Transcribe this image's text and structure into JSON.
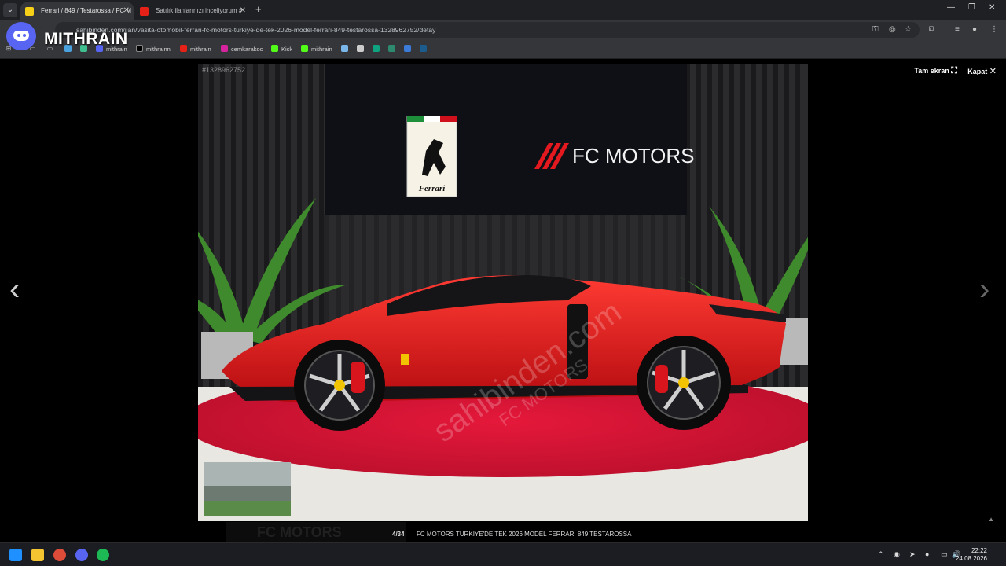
{
  "browser": {
    "tabs": [
      {
        "title": "Ferrari / 849 / Testarossa / FC M",
        "active": true
      },
      {
        "title": "Satılık ilanlarınızı inceliyorum #",
        "active": false
      }
    ],
    "url": "sahibinden.com/ilan/vasita-otomobil-ferrari-fc-motors-turkiye-de-tek-2026-model-ferrari-849-testarossa-1328962752/detay",
    "bookmarks": [
      "mithrain",
      "mithrainn",
      "mithrain",
      "cemkarakoc",
      "Kick",
      "mithrain"
    ]
  },
  "overlay": {
    "streamer": "MITHRAIN",
    "brand_color": "#5865f2"
  },
  "gallery": {
    "listing_id": "#1328962752",
    "fullscreen_label": "Tam ekran",
    "close_label": "Kapat",
    "counter": "4/34",
    "caption": "FC MOTORS TÜRKİYE'DE TEK 2026 MODEL FERRARİ 849 TESTAROSSA",
    "photo": {
      "dealer_logo": "FC MOTORS",
      "badge_text": "Ferrari",
      "watermark": "sahibinden.com",
      "watermark2": "FC MOTORS"
    },
    "accent_red": "#e3191f"
  },
  "taskbar": {
    "time": "22:22",
    "date": "24.08.2026"
  }
}
